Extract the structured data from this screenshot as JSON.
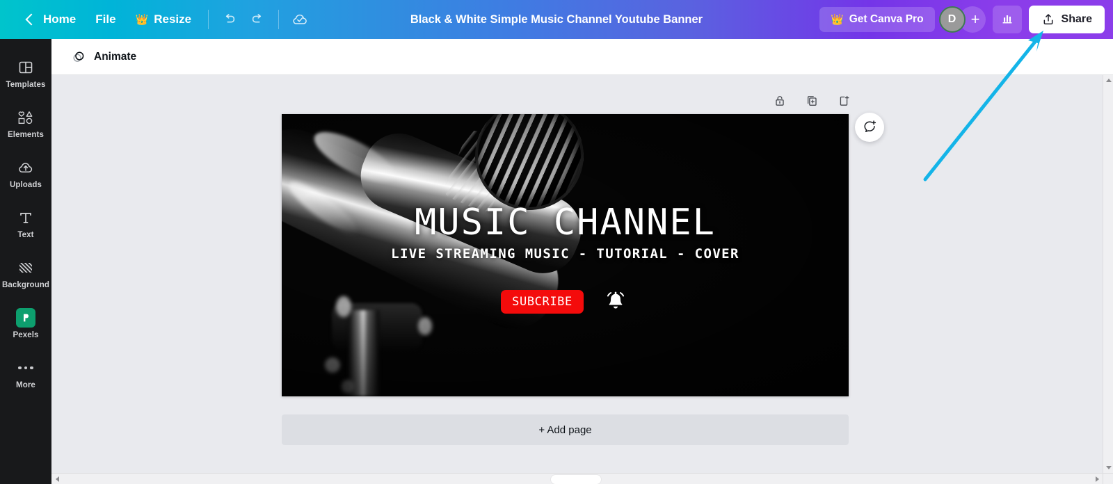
{
  "topbar": {
    "back_icon": "chevron-left-icon",
    "home_label": "Home",
    "file_label": "File",
    "resize_label": "Resize",
    "resize_crown_icon": "crown-icon",
    "undo_icon": "undo-icon",
    "redo_icon": "redo-icon",
    "cloud_icon": "cloud-saved-icon",
    "title": "Black & White Simple Music Channel Youtube Banner",
    "pro_label": "Get Canva Pro",
    "pro_crown_icon": "crown-icon",
    "avatar_initial": "D",
    "add_member_icon": "plus-icon",
    "analytics_icon": "bar-chart-icon",
    "share_label": "Share",
    "share_icon": "upload-icon",
    "gradient_start": "#00c4cc",
    "gradient_mid": "#3f7ce2",
    "gradient_end": "#8b3dea"
  },
  "sidebar": {
    "items": [
      {
        "label": "Templates",
        "icon": "templates-icon"
      },
      {
        "label": "Elements",
        "icon": "elements-icon"
      },
      {
        "label": "Uploads",
        "icon": "uploads-cloud-icon"
      },
      {
        "label": "Text",
        "icon": "text-t-icon"
      },
      {
        "label": "Background",
        "icon": "background-hatch-icon"
      },
      {
        "label": "Pexels",
        "icon": "pexels-app-icon"
      },
      {
        "label": "More",
        "icon": "more-dots-icon"
      }
    ],
    "background_color": "#18191b",
    "pexels_color": "#0d9f6e"
  },
  "subbar": {
    "animate_label": "Animate",
    "animate_icon": "animate-circles-icon"
  },
  "canvas_tools": [
    {
      "name": "lock-icon"
    },
    {
      "name": "duplicate-page-icon"
    },
    {
      "name": "add-page-icon"
    }
  ],
  "comment_fab": {
    "icon": "add-comment-icon"
  },
  "design": {
    "title": "MUSIC CHANNEL",
    "subtitle": "LIVE STREAMING MUSIC - TUTORIAL - COVER",
    "subscribe_label": "SUBCRIBE",
    "subscribe_color": "#f40b0b",
    "bell_icon": "notification-bell-icon",
    "photo": "black-and-white-microphone-photo"
  },
  "add_page": {
    "label": "+ Add page"
  },
  "annotation": {
    "type": "arrow",
    "color": "#14b4e8",
    "points_to": "share-button"
  }
}
